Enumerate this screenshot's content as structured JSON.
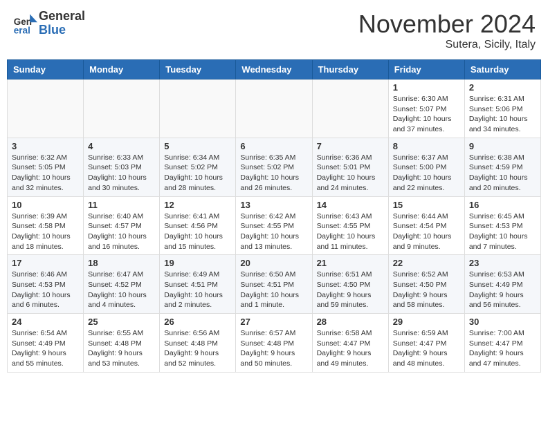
{
  "header": {
    "logo_general": "General",
    "logo_blue": "Blue",
    "month_title": "November 2024",
    "location": "Sutera, Sicily, Italy"
  },
  "weekdays": [
    "Sunday",
    "Monday",
    "Tuesday",
    "Wednesday",
    "Thursday",
    "Friday",
    "Saturday"
  ],
  "weeks": [
    [
      {
        "day": "",
        "info": ""
      },
      {
        "day": "",
        "info": ""
      },
      {
        "day": "",
        "info": ""
      },
      {
        "day": "",
        "info": ""
      },
      {
        "day": "",
        "info": ""
      },
      {
        "day": "1",
        "info": "Sunrise: 6:30 AM\nSunset: 5:07 PM\nDaylight: 10 hours and 37 minutes."
      },
      {
        "day": "2",
        "info": "Sunrise: 6:31 AM\nSunset: 5:06 PM\nDaylight: 10 hours and 34 minutes."
      }
    ],
    [
      {
        "day": "3",
        "info": "Sunrise: 6:32 AM\nSunset: 5:05 PM\nDaylight: 10 hours and 32 minutes."
      },
      {
        "day": "4",
        "info": "Sunrise: 6:33 AM\nSunset: 5:03 PM\nDaylight: 10 hours and 30 minutes."
      },
      {
        "day": "5",
        "info": "Sunrise: 6:34 AM\nSunset: 5:02 PM\nDaylight: 10 hours and 28 minutes."
      },
      {
        "day": "6",
        "info": "Sunrise: 6:35 AM\nSunset: 5:02 PM\nDaylight: 10 hours and 26 minutes."
      },
      {
        "day": "7",
        "info": "Sunrise: 6:36 AM\nSunset: 5:01 PM\nDaylight: 10 hours and 24 minutes."
      },
      {
        "day": "8",
        "info": "Sunrise: 6:37 AM\nSunset: 5:00 PM\nDaylight: 10 hours and 22 minutes."
      },
      {
        "day": "9",
        "info": "Sunrise: 6:38 AM\nSunset: 4:59 PM\nDaylight: 10 hours and 20 minutes."
      }
    ],
    [
      {
        "day": "10",
        "info": "Sunrise: 6:39 AM\nSunset: 4:58 PM\nDaylight: 10 hours and 18 minutes."
      },
      {
        "day": "11",
        "info": "Sunrise: 6:40 AM\nSunset: 4:57 PM\nDaylight: 10 hours and 16 minutes."
      },
      {
        "day": "12",
        "info": "Sunrise: 6:41 AM\nSunset: 4:56 PM\nDaylight: 10 hours and 15 minutes."
      },
      {
        "day": "13",
        "info": "Sunrise: 6:42 AM\nSunset: 4:55 PM\nDaylight: 10 hours and 13 minutes."
      },
      {
        "day": "14",
        "info": "Sunrise: 6:43 AM\nSunset: 4:55 PM\nDaylight: 10 hours and 11 minutes."
      },
      {
        "day": "15",
        "info": "Sunrise: 6:44 AM\nSunset: 4:54 PM\nDaylight: 10 hours and 9 minutes."
      },
      {
        "day": "16",
        "info": "Sunrise: 6:45 AM\nSunset: 4:53 PM\nDaylight: 10 hours and 7 minutes."
      }
    ],
    [
      {
        "day": "17",
        "info": "Sunrise: 6:46 AM\nSunset: 4:53 PM\nDaylight: 10 hours and 6 minutes."
      },
      {
        "day": "18",
        "info": "Sunrise: 6:47 AM\nSunset: 4:52 PM\nDaylight: 10 hours and 4 minutes."
      },
      {
        "day": "19",
        "info": "Sunrise: 6:49 AM\nSunset: 4:51 PM\nDaylight: 10 hours and 2 minutes."
      },
      {
        "day": "20",
        "info": "Sunrise: 6:50 AM\nSunset: 4:51 PM\nDaylight: 10 hours and 1 minute."
      },
      {
        "day": "21",
        "info": "Sunrise: 6:51 AM\nSunset: 4:50 PM\nDaylight: 9 hours and 59 minutes."
      },
      {
        "day": "22",
        "info": "Sunrise: 6:52 AM\nSunset: 4:50 PM\nDaylight: 9 hours and 58 minutes."
      },
      {
        "day": "23",
        "info": "Sunrise: 6:53 AM\nSunset: 4:49 PM\nDaylight: 9 hours and 56 minutes."
      }
    ],
    [
      {
        "day": "24",
        "info": "Sunrise: 6:54 AM\nSunset: 4:49 PM\nDaylight: 9 hours and 55 minutes."
      },
      {
        "day": "25",
        "info": "Sunrise: 6:55 AM\nSunset: 4:48 PM\nDaylight: 9 hours and 53 minutes."
      },
      {
        "day": "26",
        "info": "Sunrise: 6:56 AM\nSunset: 4:48 PM\nDaylight: 9 hours and 52 minutes."
      },
      {
        "day": "27",
        "info": "Sunrise: 6:57 AM\nSunset: 4:48 PM\nDaylight: 9 hours and 50 minutes."
      },
      {
        "day": "28",
        "info": "Sunrise: 6:58 AM\nSunset: 4:47 PM\nDaylight: 9 hours and 49 minutes."
      },
      {
        "day": "29",
        "info": "Sunrise: 6:59 AM\nSunset: 4:47 PM\nDaylight: 9 hours and 48 minutes."
      },
      {
        "day": "30",
        "info": "Sunrise: 7:00 AM\nSunset: 4:47 PM\nDaylight: 9 hours and 47 minutes."
      }
    ]
  ]
}
